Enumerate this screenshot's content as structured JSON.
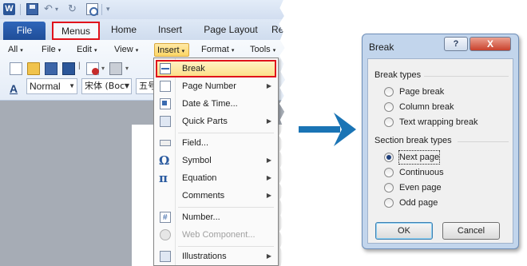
{
  "window": {
    "qat": {
      "word_logo": "W"
    },
    "tabs": {
      "file": "File",
      "menus": "Menus",
      "home": "Home",
      "insert": "Insert",
      "page_layout": "Page Layout",
      "cut": "Re"
    },
    "menubar": {
      "all": "All",
      "file": "File",
      "edit": "Edit",
      "view": "View",
      "insert": "Insert",
      "format": "Format",
      "tools": "Tools"
    },
    "formatting": {
      "style_value": "Normal",
      "font_value": "宋体 (Boc",
      "size_value": "五号"
    }
  },
  "insert_menu": {
    "items": [
      {
        "label": "Break",
        "has_submenu": false,
        "icon": "page-break-icon"
      },
      {
        "label": "Page Number",
        "has_submenu": true,
        "icon": "page-number-icon"
      },
      {
        "label": "Date & Time...",
        "has_submenu": false,
        "icon": "calendar-icon"
      },
      {
        "label": "Quick Parts",
        "has_submenu": true,
        "icon": "quick-parts-icon"
      },
      {
        "label": "Field...",
        "has_submenu": false,
        "icon": "field-icon"
      },
      {
        "label": "Symbol",
        "has_submenu": true,
        "icon": "omega-icon"
      },
      {
        "label": "Equation",
        "has_submenu": true,
        "icon": "pi-icon"
      },
      {
        "label": "Comments",
        "has_submenu": true,
        "icon": ""
      },
      {
        "label": "Number...",
        "has_submenu": false,
        "icon": "number-icon"
      },
      {
        "label": "Web Component...",
        "has_submenu": false,
        "icon": "globe-icon",
        "disabled": true
      },
      {
        "label": "Illustrations",
        "has_submenu": true,
        "icon": "illustrations-icon"
      }
    ]
  },
  "dialog": {
    "title": "Break",
    "help_label": "?",
    "close_label": "X",
    "break_types_label": "Break types",
    "break_types": [
      {
        "label": "Page break",
        "selected": false
      },
      {
        "label": "Column break",
        "selected": false
      },
      {
        "label": "Text wrapping break",
        "selected": false
      }
    ],
    "section_types_label": "Section break types",
    "section_types": [
      {
        "label": "Next page",
        "selected": true
      },
      {
        "label": "Continuous",
        "selected": false
      },
      {
        "label": "Even page",
        "selected": false
      },
      {
        "label": "Odd page",
        "selected": false
      }
    ],
    "ok_label": "OK",
    "cancel_label": "Cancel"
  },
  "colors": {
    "highlight_border": "#e0121b",
    "arrow": "#1a74b5",
    "file_tab": "#2a5caa",
    "menu_hover": "#fde08a"
  }
}
